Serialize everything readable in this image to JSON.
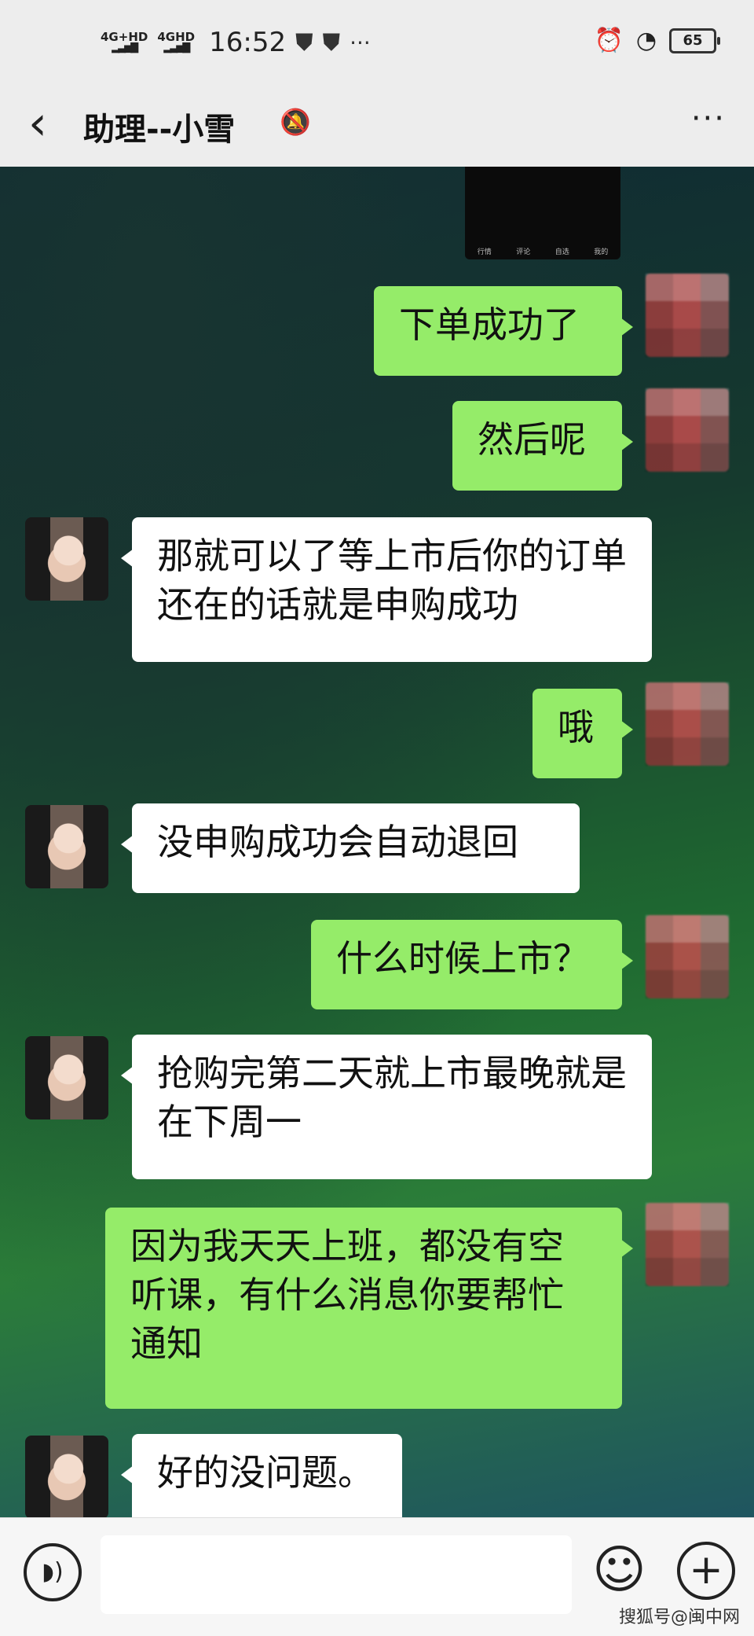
{
  "status_bar": {
    "net1": "4G+HD",
    "net2": "4GHD",
    "time": "16:52",
    "dots": "···",
    "battery": "65"
  },
  "header": {
    "back_icon": "chevron-left-icon",
    "title": "助理--小雪",
    "mute_icon": "bell-off-icon",
    "more": "···"
  },
  "messages": [
    {
      "sender": "me",
      "text": "下单成功了"
    },
    {
      "sender": "me",
      "text": "然后呢"
    },
    {
      "sender": "them",
      "text": "那就可以了等上市后你的订单还在的话就是申购成功"
    },
    {
      "sender": "me",
      "text": "哦"
    },
    {
      "sender": "them",
      "text": "没申购成功会自动退回"
    },
    {
      "sender": "me",
      "text": "什么时候上市？"
    },
    {
      "sender": "them",
      "text": "抢购完第二天就上市最晚就是在下周一"
    },
    {
      "sender": "me",
      "text": "因为我天天上班，都没有空听课，有什么消息你要帮忙通知"
    },
    {
      "sender": "them",
      "text": "好的没问题。"
    }
  ],
  "thumbnail_tabs": [
    "行情",
    "评论",
    "自选",
    "我的"
  ],
  "input_bar": {
    "voice_icon": "voice-icon",
    "emoji_icon": "emoji-icon",
    "plus_icon": "plus-icon"
  },
  "watermark": "搜狐号@闽中网",
  "colors": {
    "my_bubble": "#95ec69",
    "their_bubble": "#ffffff",
    "header_bg": "#ededed"
  }
}
